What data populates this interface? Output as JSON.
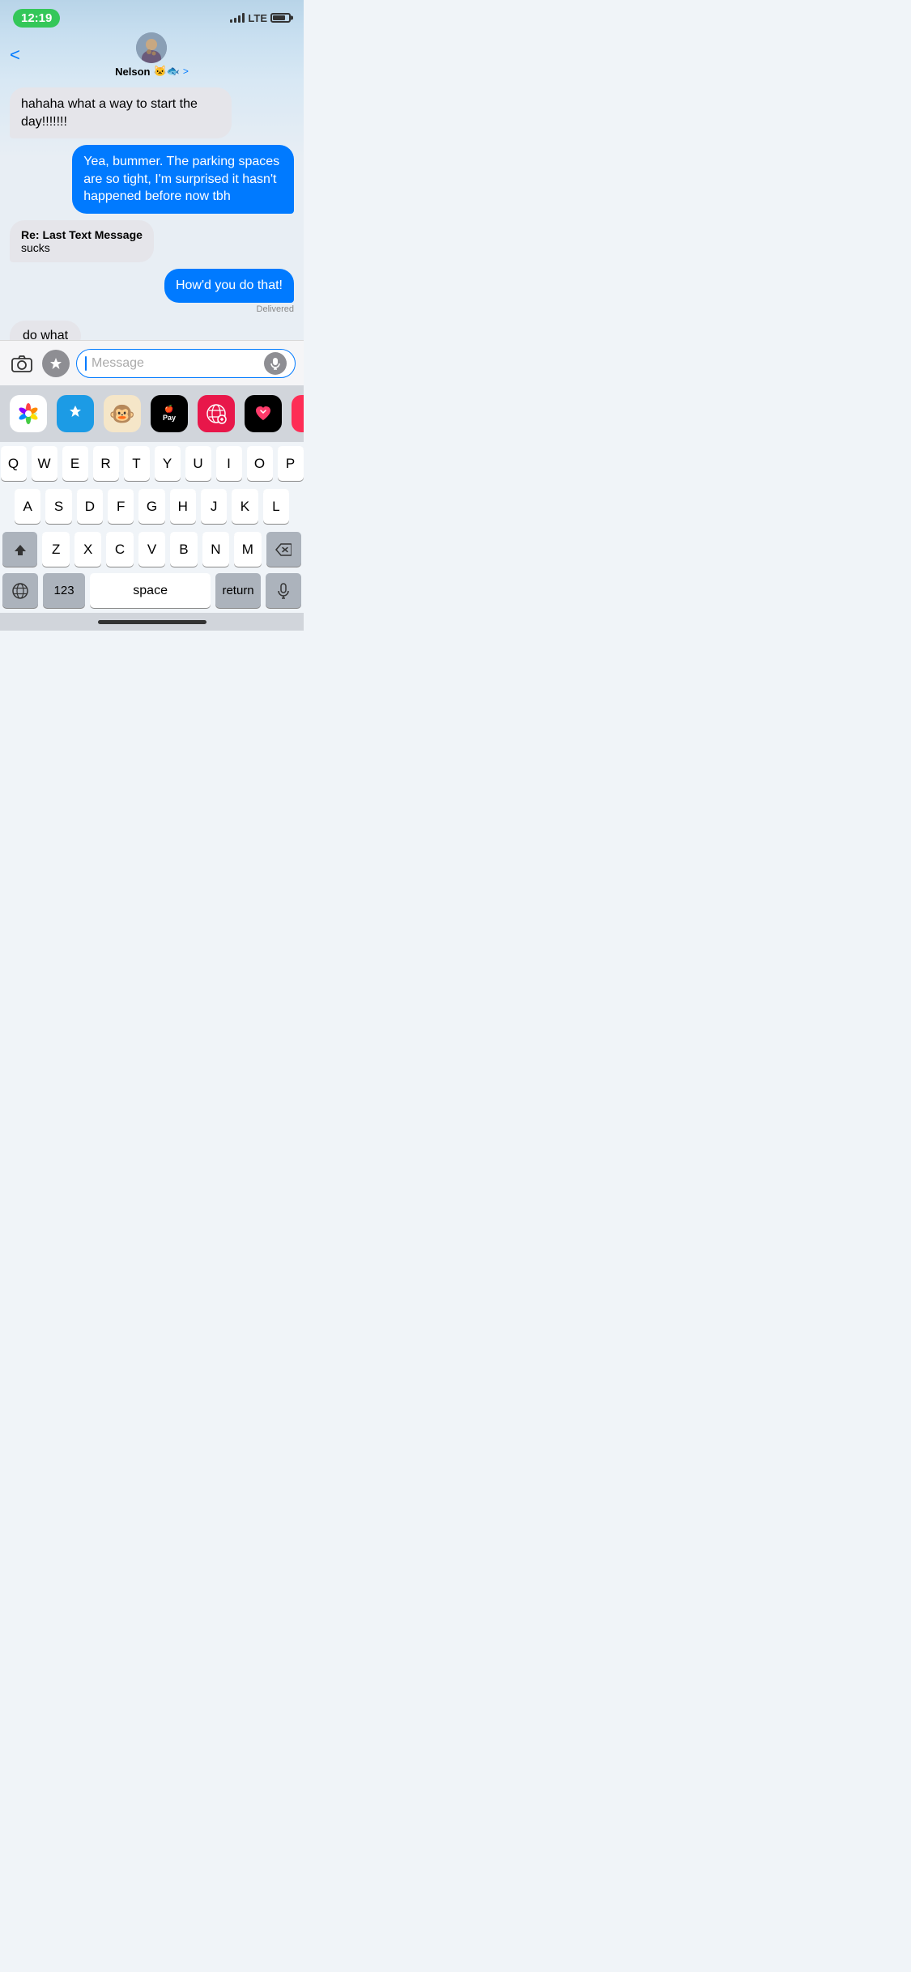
{
  "statusBar": {
    "time": "12:19",
    "lte": "LTE"
  },
  "header": {
    "backLabel": "<",
    "contactName": "Nelson",
    "contactEmojis": "🐱🐟",
    "chevron": ">"
  },
  "messages": [
    {
      "id": "msg1",
      "type": "received",
      "text": "hahaha what a way to start the day!!!!!!!",
      "partial": true
    },
    {
      "id": "msg2",
      "type": "sent",
      "text": "Yea, bummer. The parking spaces are so tight, I'm surprised it hasn't happened before now tbh"
    },
    {
      "id": "msg3",
      "type": "received",
      "isReply": true,
      "replyHeader": "Re: Last Text Message",
      "replyBody": "sucks"
    },
    {
      "id": "msg4",
      "type": "sent",
      "text": "How'd you do that!",
      "status": "Delivered"
    },
    {
      "id": "msg5",
      "type": "received",
      "text": "do what"
    }
  ],
  "inputBar": {
    "placeholder": "Message",
    "cameraIcon": "📷",
    "appstoreIcon": "A"
  },
  "appTray": {
    "apps": [
      {
        "name": "Photos",
        "emoji": "🌅",
        "bg": "#fff"
      },
      {
        "name": "AppStore",
        "emoji": "A",
        "bg": "#1c9be5"
      },
      {
        "name": "Monkey",
        "emoji": "🐵",
        "bg": "#e8c06a"
      },
      {
        "name": "ApplePay",
        "label": "Apple Pay",
        "bg": "#000"
      },
      {
        "name": "Search",
        "emoji": "🔍",
        "bg": "#e8174a"
      },
      {
        "name": "Heart",
        "emoji": "❤️",
        "bg": "#000"
      },
      {
        "name": "Music",
        "emoji": "♪",
        "bg": "#fe2d55"
      }
    ]
  },
  "keyboard": {
    "rows": [
      [
        "Q",
        "W",
        "E",
        "R",
        "T",
        "Y",
        "U",
        "I",
        "O",
        "P"
      ],
      [
        "A",
        "S",
        "D",
        "F",
        "G",
        "H",
        "J",
        "K",
        "L"
      ],
      [
        "⇧",
        "Z",
        "X",
        "C",
        "V",
        "B",
        "N",
        "M",
        "⌫"
      ]
    ],
    "bottomRow": {
      "num": "123",
      "space": "space",
      "return": "return",
      "globeIcon": "🌐",
      "micIcon": "🎤"
    }
  }
}
